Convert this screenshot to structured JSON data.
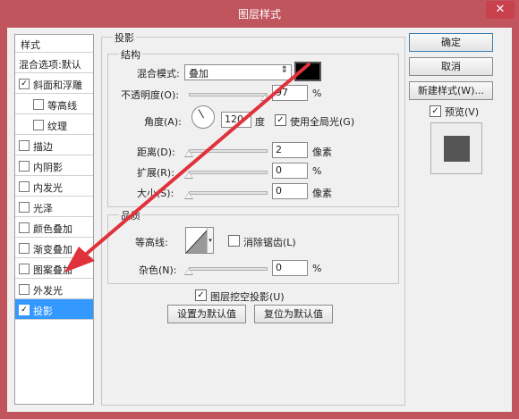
{
  "window": {
    "title": "图层样式",
    "close": "✕"
  },
  "styles_list": {
    "header": "样式",
    "items": [
      {
        "label": "混合选项:默认",
        "checkbox": false,
        "checked": false,
        "indent": false,
        "selected": false
      },
      {
        "label": "斜面和浮雕",
        "checkbox": true,
        "checked": true,
        "indent": false,
        "selected": false
      },
      {
        "label": "等高线",
        "checkbox": true,
        "checked": false,
        "indent": true,
        "selected": false
      },
      {
        "label": "纹理",
        "checkbox": true,
        "checked": false,
        "indent": true,
        "selected": false
      },
      {
        "label": "描边",
        "checkbox": true,
        "checked": false,
        "indent": false,
        "selected": false
      },
      {
        "label": "内阴影",
        "checkbox": true,
        "checked": false,
        "indent": false,
        "selected": false
      },
      {
        "label": "内发光",
        "checkbox": true,
        "checked": false,
        "indent": false,
        "selected": false
      },
      {
        "label": "光泽",
        "checkbox": true,
        "checked": false,
        "indent": false,
        "selected": false
      },
      {
        "label": "颜色叠加",
        "checkbox": true,
        "checked": false,
        "indent": false,
        "selected": false
      },
      {
        "label": "渐变叠加",
        "checkbox": true,
        "checked": false,
        "indent": false,
        "selected": false
      },
      {
        "label": "图案叠加",
        "checkbox": true,
        "checked": false,
        "indent": false,
        "selected": false
      },
      {
        "label": "外发光",
        "checkbox": true,
        "checked": false,
        "indent": false,
        "selected": false
      },
      {
        "label": "投影",
        "checkbox": true,
        "checked": true,
        "indent": false,
        "selected": true
      }
    ],
    "checkmark": "✓"
  },
  "drop_shadow": {
    "section_title": "投影",
    "structure": {
      "title": "结构",
      "blend_mode_label": "混合模式:",
      "blend_mode_value": "叠加",
      "blend_arrow": "⇕",
      "shadow_color": "#000000",
      "opacity_label": "不透明度(O):",
      "opacity_value": "97",
      "opacity_unit": "%",
      "opacity_fraction": 0.97,
      "angle_label": "角度(A):",
      "angle_value": "120",
      "angle_unit": "度",
      "global_light_label": "使用全局光(G)",
      "global_light_checked": true,
      "distance_label": "距离(D):",
      "distance_value": "2",
      "distance_unit": "像素",
      "distance_fraction": 0.0,
      "spread_label": "扩展(R):",
      "spread_value": "0",
      "spread_unit": "%",
      "spread_fraction": 0.0,
      "size_label": "大小(S):",
      "size_value": "0",
      "size_unit": "像素",
      "size_fraction": 0.0
    },
    "quality": {
      "title": "品质",
      "contour_label": "等高线:",
      "antialias_label": "消除锯齿(L)",
      "antialias_checked": false,
      "noise_label": "杂色(N):",
      "noise_value": "0",
      "noise_unit": "%",
      "noise_fraction": 0.0
    },
    "knockout_label": "图层挖空投影(U)",
    "knockout_checked": true,
    "set_default_label": "设置为默认值",
    "reset_default_label": "复位为默认值"
  },
  "buttons": {
    "ok": "确定",
    "cancel": "取消",
    "new_style": "新建样式(W)...",
    "preview_label": "预览(V)",
    "preview_checked": true
  },
  "colors": {
    "title_bar": "#c0555e",
    "selection": "#3399ff",
    "annotation_arrow": "#e0323c"
  },
  "icons": [
    "close-icon",
    "checkbox-icon",
    "dropdown-arrow-icon",
    "angle-dial-icon",
    "contour-curve-icon",
    "slider-thumb-icon"
  ]
}
